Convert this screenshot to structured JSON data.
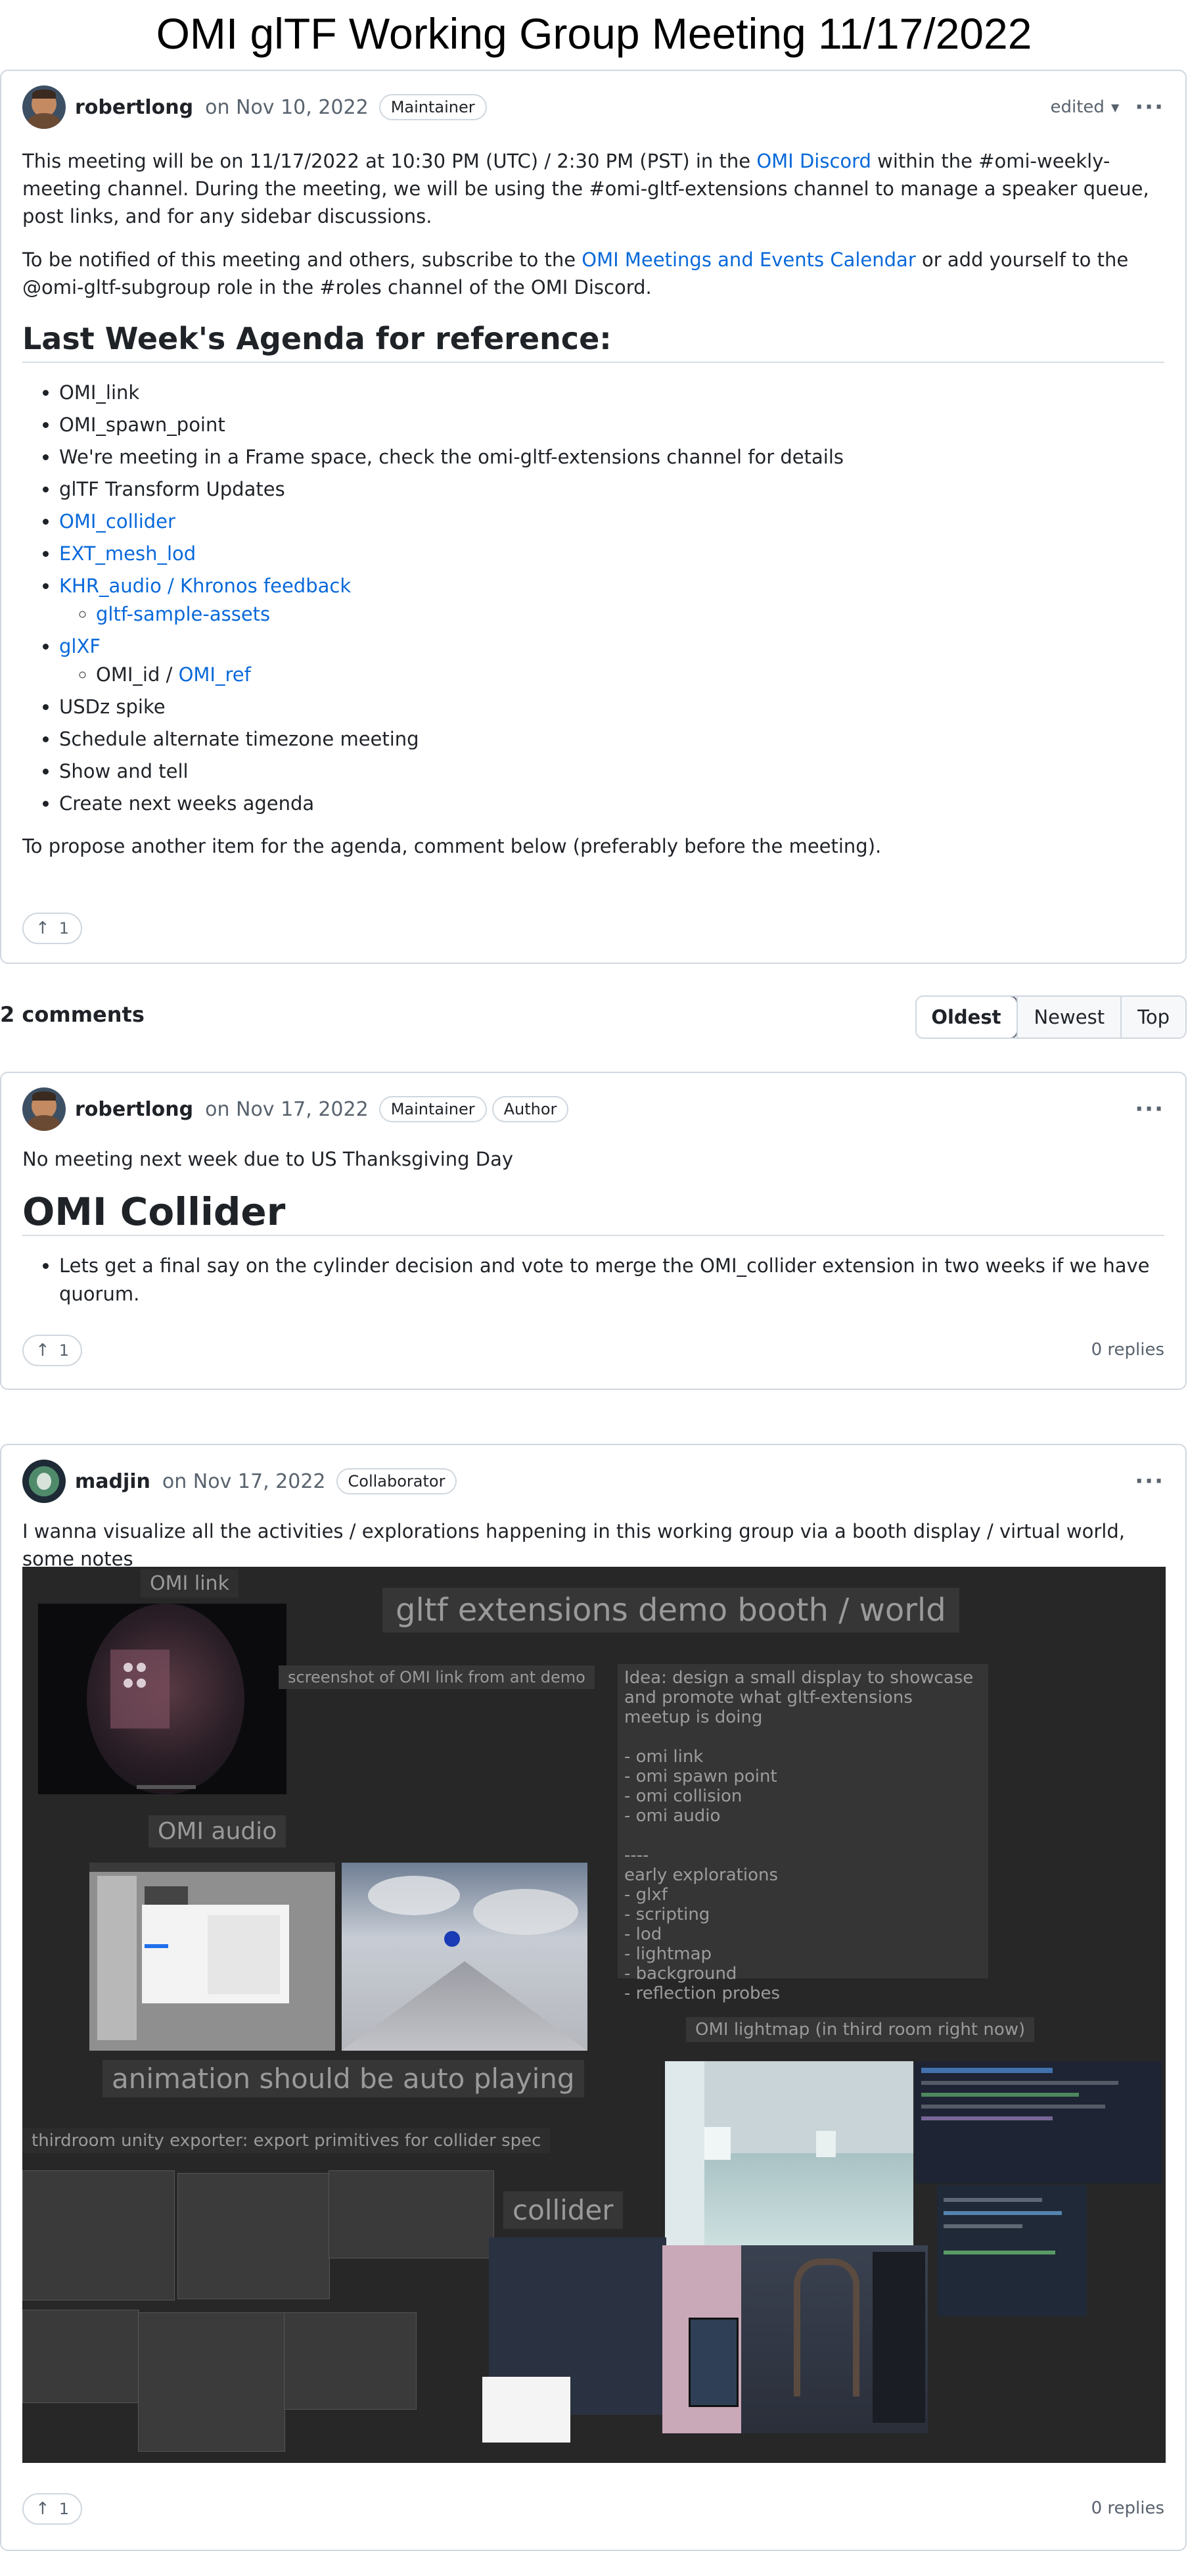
{
  "page": {
    "title": "OMI glTF Working Group Meeting 11/17/2022"
  },
  "post": {
    "author": "robertlong",
    "date": "on Nov 10, 2022",
    "badge": "Maintainer",
    "edited_label": "edited",
    "para1_a": "This meeting will be on 11/17/2022 at 10:30 PM (UTC) / 2:30 PM (PST) in the ",
    "para1_link": "OMI Discord",
    "para1_b": " within the #omi-weekly-meeting channel. During the meeting, we will be using the #omi-gltf-extensions channel to manage a speaker queue, post links, and for any sidebar discussions.",
    "para2_a": "To be notified of this meeting and others, subscribe to the ",
    "para2_link": "OMI Meetings and Events Calendar",
    "para2_b": " or add yourself to the @omi-gltf-subgroup role in the #roles channel of the OMI Discord.",
    "agenda_heading": "Last Week's Agenda for reference:",
    "agenda": {
      "i1": "OMI_link",
      "i2": "OMI_spawn_point",
      "i3": "We're meeting in a Frame space, check the omi-gltf-extensions channel for details",
      "i4": "glTF Transform Updates",
      "i5": "OMI_collider",
      "i6": "EXT_mesh_lod",
      "i7": "KHR_audio / Khronos feedback",
      "i7_sub": "gltf-sample-assets",
      "i8": "glXF",
      "i8_sub_a": "OMI_id / ",
      "i8_sub_link": "OMI_ref",
      "i9": "USDz spike",
      "i10": "Schedule alternate timezone meeting",
      "i11": "Show and tell",
      "i12": "Create next weeks agenda"
    },
    "footer_note": "To propose another item for the agenda, comment below (preferably before the meeting).",
    "upvotes": "1"
  },
  "comments_header": {
    "count_label": "2 comments",
    "sort_options": [
      "Oldest",
      "Newest",
      "Top"
    ]
  },
  "comment1": {
    "author": "robertlong",
    "date": "on Nov 17, 2022",
    "badge1": "Maintainer",
    "badge2": "Author",
    "text": "No meeting next week due to US Thanksgiving Day",
    "heading": "OMI Collider",
    "bullet": "Lets get a final say on the cylinder decision and vote to merge the OMI_collider extension in two weeks if we have quorum.",
    "upvotes": "1",
    "replies": "0 replies"
  },
  "comment2": {
    "author": "madjin",
    "date": "on Nov 17, 2022",
    "badge": "Collaborator",
    "text": "I wanna visualize all the activities / explorations happening in this working group via a booth display / virtual world, some notes",
    "upvotes": "1",
    "replies": "0 replies",
    "collage": {
      "omi_link": "OMI link",
      "booth_title": "gltf extensions demo booth / world",
      "screenshot_caption": "screenshot of OMI link from ant demo",
      "idea_text": "Idea: design a small display to showcase and promote what gltf-extensions meetup is doing\n\n- omi link\n- omi spawn point\n- omi collision\n- omi audio\n\n----\nearly explorations\n- glxf\n- scripting\n- lod\n- lightmap\n- background\n- reflection probes",
      "omi_audio": "OMI audio",
      "animation_note": "animation should be auto playing",
      "lightmap": "OMI lightmap (in third room right now)",
      "exporter": "thirdroom unity exporter: export primitives for collider spec",
      "collider": "collider"
    }
  },
  "colors": {
    "link": "#0969da",
    "border": "#d0d7de",
    "muted": "#59636e",
    "collage_bg": "#272727"
  }
}
